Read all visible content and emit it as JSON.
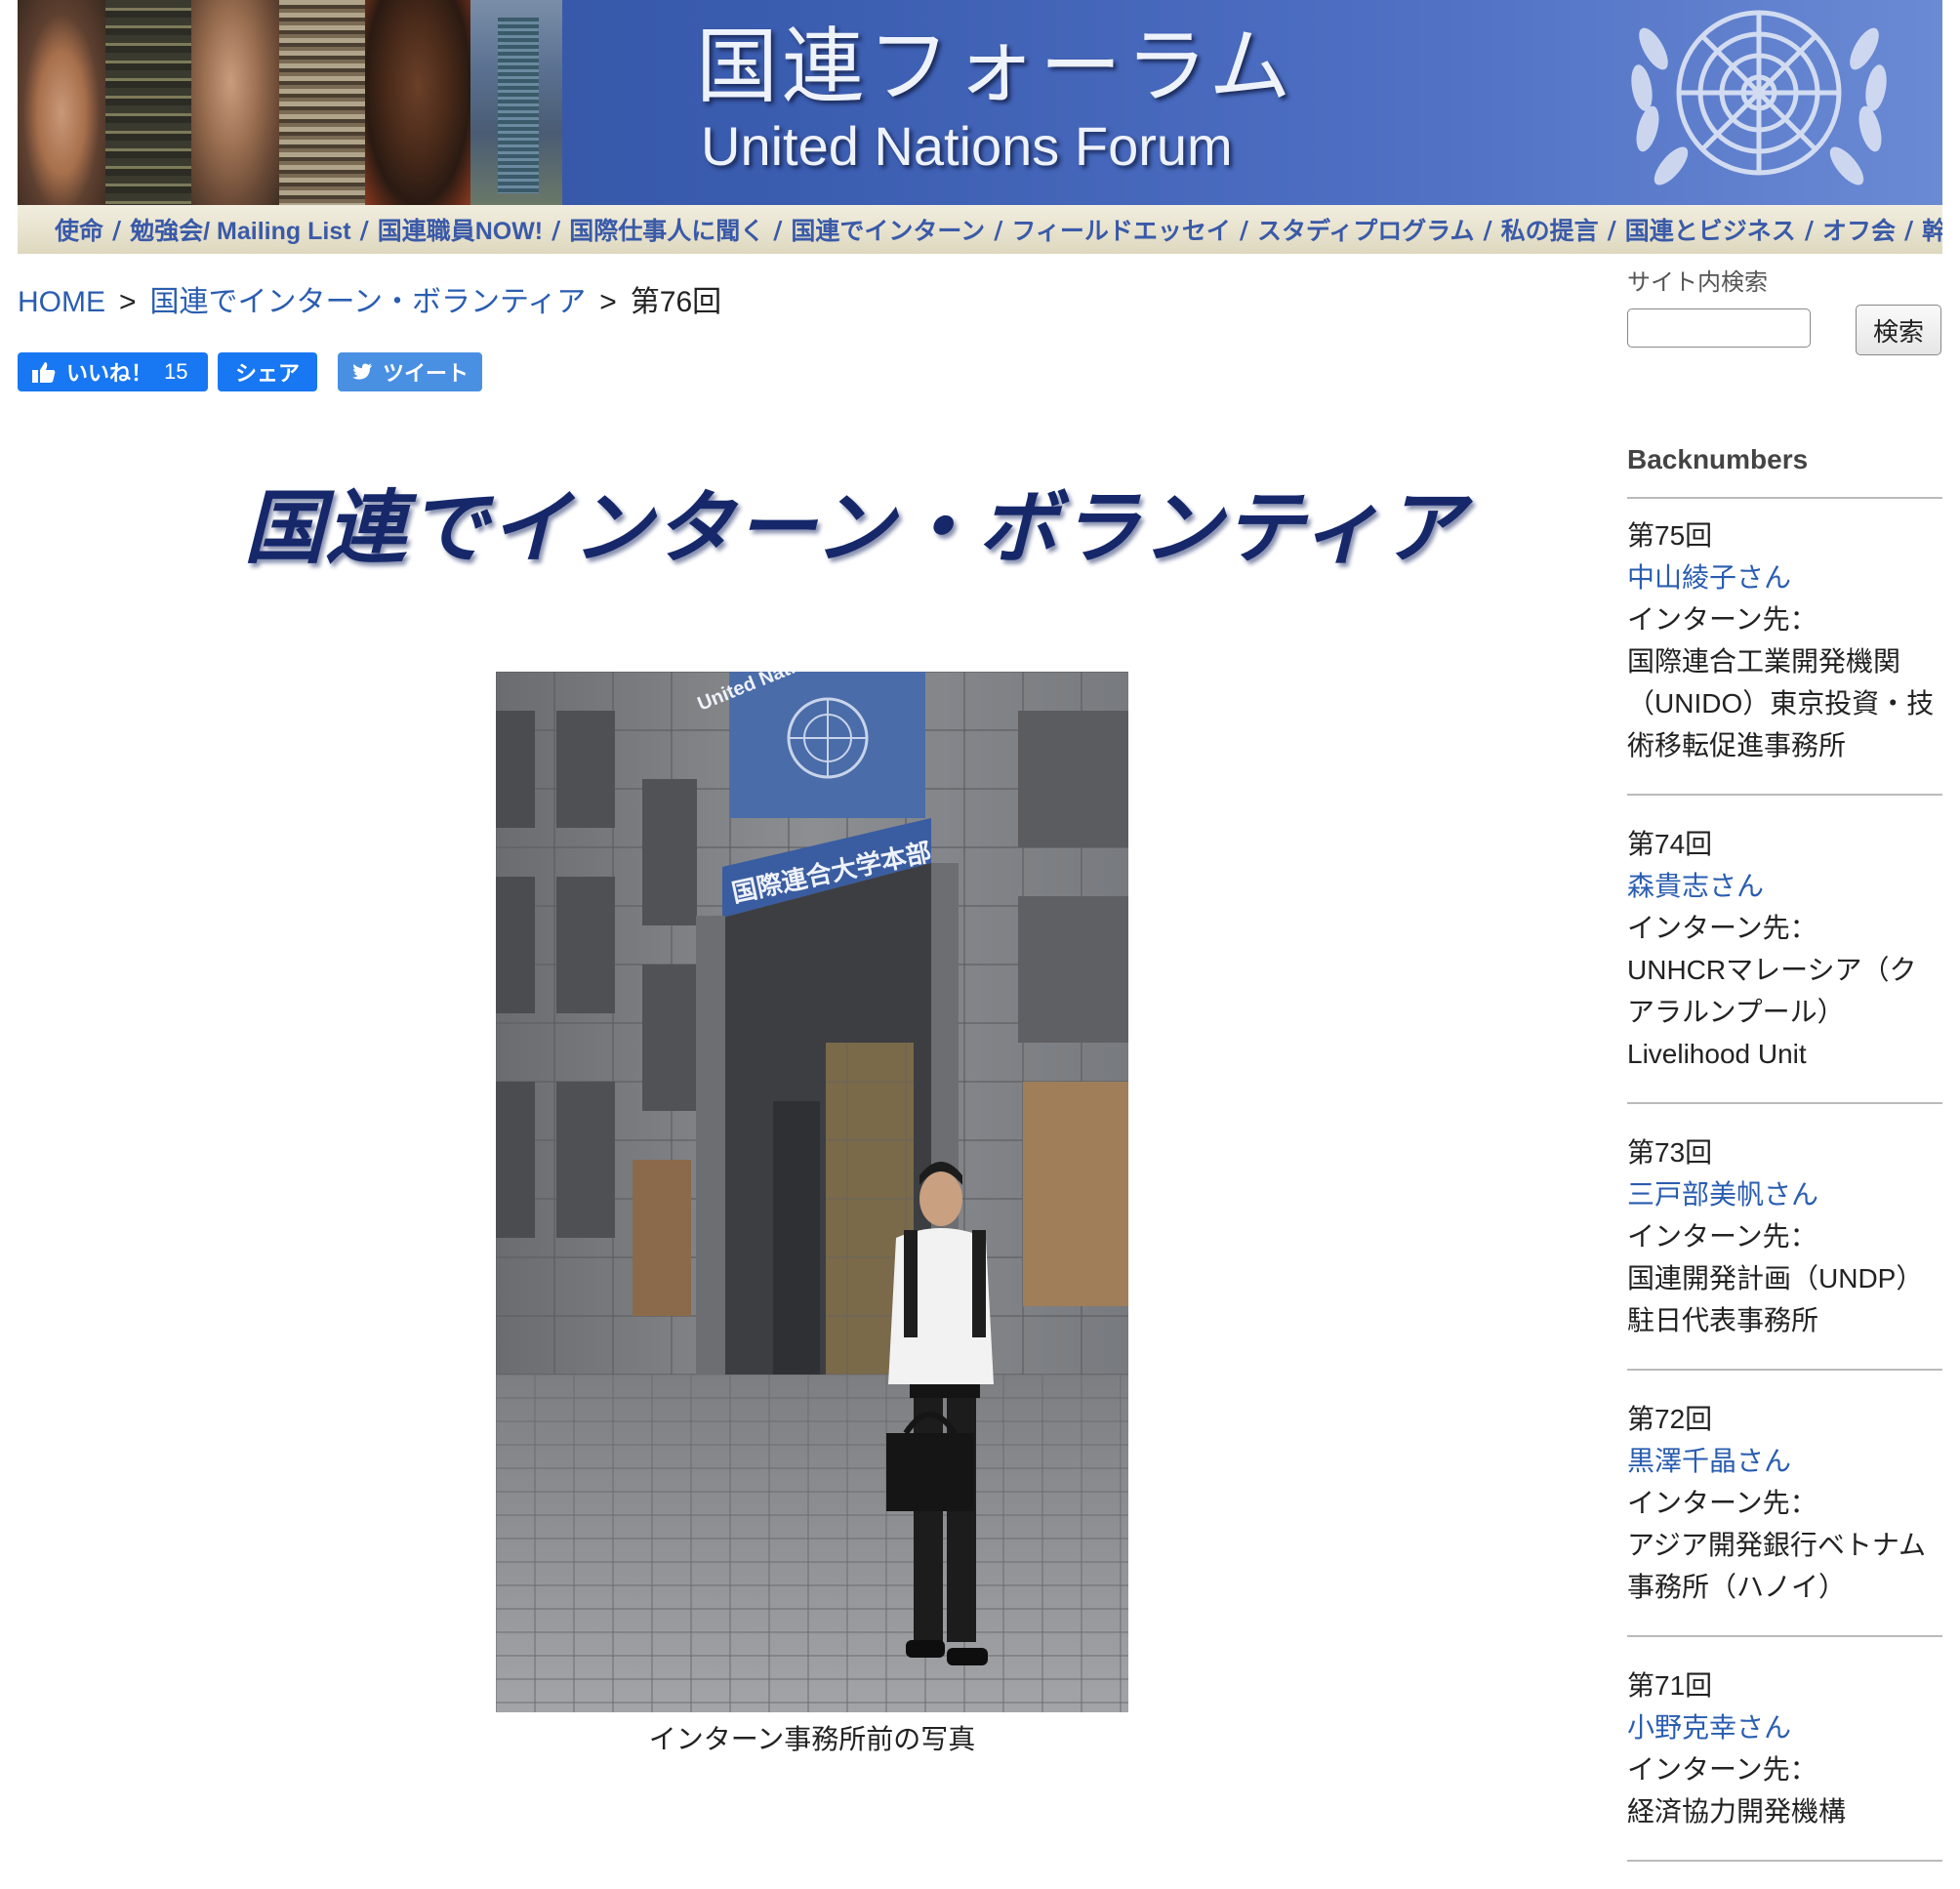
{
  "banner": {
    "title_ja": "国連フォーラム",
    "title_en": "United Nations Forum",
    "nav": [
      "使命",
      "勉強会/ Mailing List",
      "国連職員NOW!",
      "国際仕事人に聞く",
      "国連でインターン",
      "フィールドエッセイ",
      "スタディプログラム",
      "私の提言",
      "国連とビジネス",
      "オフ会",
      "幹事会"
    ]
  },
  "breadcrumb": {
    "home": "HOME",
    "section": "国連でインターン・ボランティア",
    "current": "第76回",
    "separator": ">"
  },
  "social": {
    "like_label": "いいね！",
    "like_count": "15",
    "share_label": "シェア",
    "tweet_label": "ツイート"
  },
  "main": {
    "section_title": "国連でインターン・ボランティア",
    "photo_sign_en": "United Nations",
    "photo_sign_ja": "国際連合大学本部",
    "photo_caption": "インターン事務所前の写真"
  },
  "sidebar": {
    "search_label": "サイト内検索",
    "search_button": "検索",
    "backnumbers_heading": "Backnumbers",
    "entries": [
      {
        "num": "第75回",
        "name": "中山綾子さん",
        "label": "インターン先：",
        "org": "国際連合工業開発機関（UNIDO）東京投資・技術移転促進事務所"
      },
      {
        "num": "第74回",
        "name": "森貴志さん",
        "label": "インターン先：",
        "org": "UNHCRマレーシア（クアラルンプール）Livelihood Unit"
      },
      {
        "num": "第73回",
        "name": "三戸部美帆さん",
        "label": "インターン先：",
        "org": "国連開発計画（UNDP）駐日代表事務所"
      },
      {
        "num": "第72回",
        "name": "黒澤千晶さん",
        "label": "インターン先：",
        "org": "アジア開発銀行ベトナム事務所（ハノイ）"
      },
      {
        "num": "第71回",
        "name": "小野克幸さん",
        "label": "インターン先：",
        "org": "経済協力開発機構"
      }
    ]
  },
  "colors": {
    "link": "#2a5db0",
    "banner_blue": "#3b5db0",
    "facebook": "#1877f2",
    "twitter": "#4a90e2",
    "title_navy": "#16286a"
  }
}
